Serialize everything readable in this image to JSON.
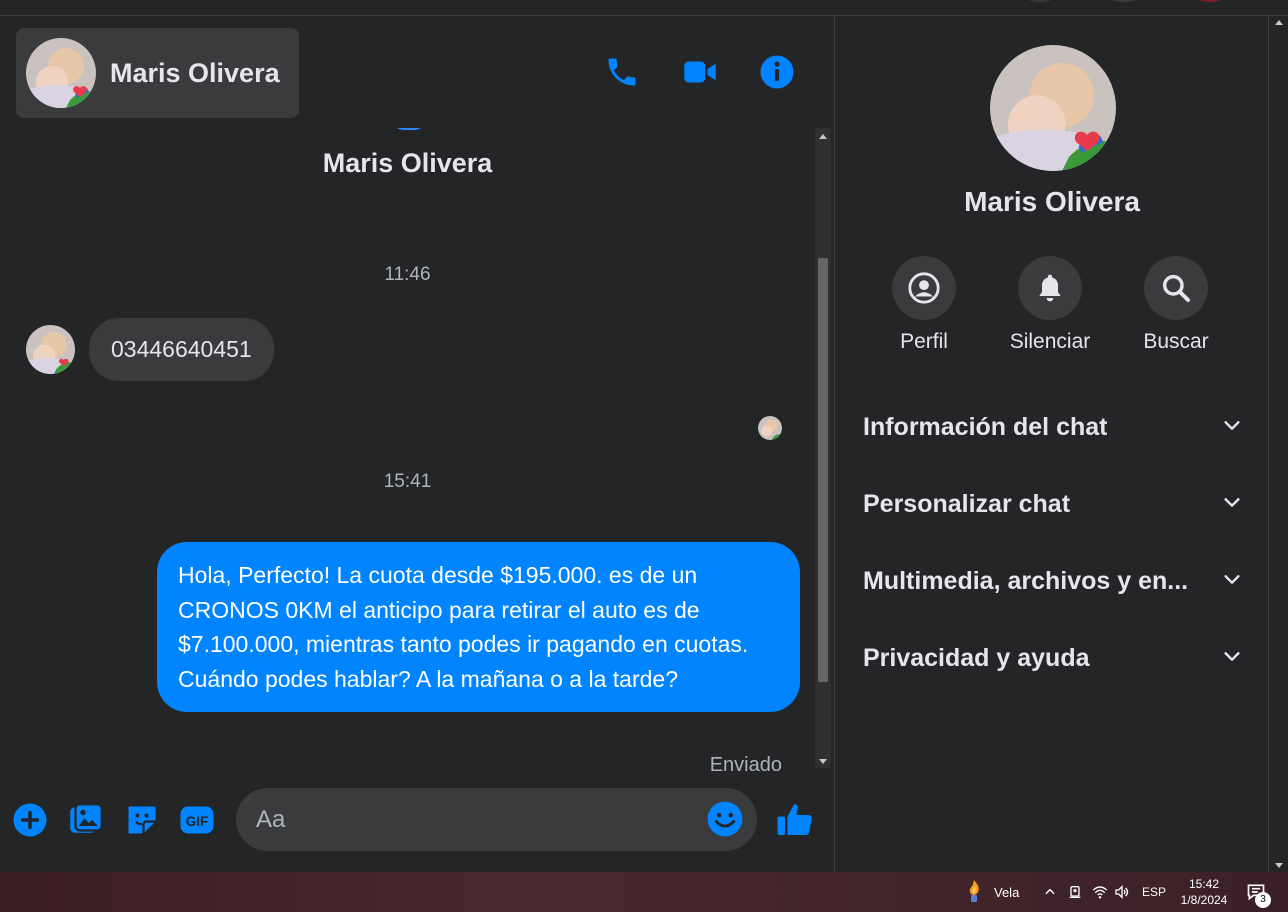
{
  "contact": {
    "name": "Maris Olivera"
  },
  "header": {
    "call_icon": "phone-icon",
    "video_icon": "video-camera-icon",
    "info_icon": "info-icon"
  },
  "conversation": {
    "top_name": "Maris Olivera",
    "time_1": "11:46",
    "incoming_message": "03446640451",
    "time_2": "15:41",
    "outgoing_message": "Hola, Perfecto! La cuota desde $195.000. es de un CRONOS 0KM el anticipo para retirar el auto es de $7.100.000, mientras tanto podes ir pagando en cuotas. Cuándo podes hablar? A la mañana o a la tarde?",
    "status": "Enviado"
  },
  "composer": {
    "placeholder": "Aa",
    "icons": [
      "plus-icon",
      "image-icon",
      "sticker-icon",
      "gif-icon",
      "emoji-icon",
      "like-icon"
    ]
  },
  "info_panel": {
    "name": "Maris Olivera",
    "actions": [
      {
        "label": "Perfil",
        "icon": "profile-icon"
      },
      {
        "label": "Silenciar",
        "icon": "bell-icon"
      },
      {
        "label": "Buscar",
        "icon": "search-icon"
      }
    ],
    "sections": [
      {
        "title": "Información del chat"
      },
      {
        "title": "Personalizar chat"
      },
      {
        "title": "Multimedia, archivos y en..."
      },
      {
        "title": "Privacidad y ayuda"
      }
    ]
  },
  "taskbar": {
    "app_label": "Vela",
    "language": "ESP",
    "time": "15:42",
    "date": "1/8/2024",
    "notification_count": "3"
  },
  "colors": {
    "accent": "#0084ff",
    "background": "#242526",
    "surface": "#3a3b3c",
    "text": "#e4e6eb",
    "muted": "#b0b3b8"
  }
}
